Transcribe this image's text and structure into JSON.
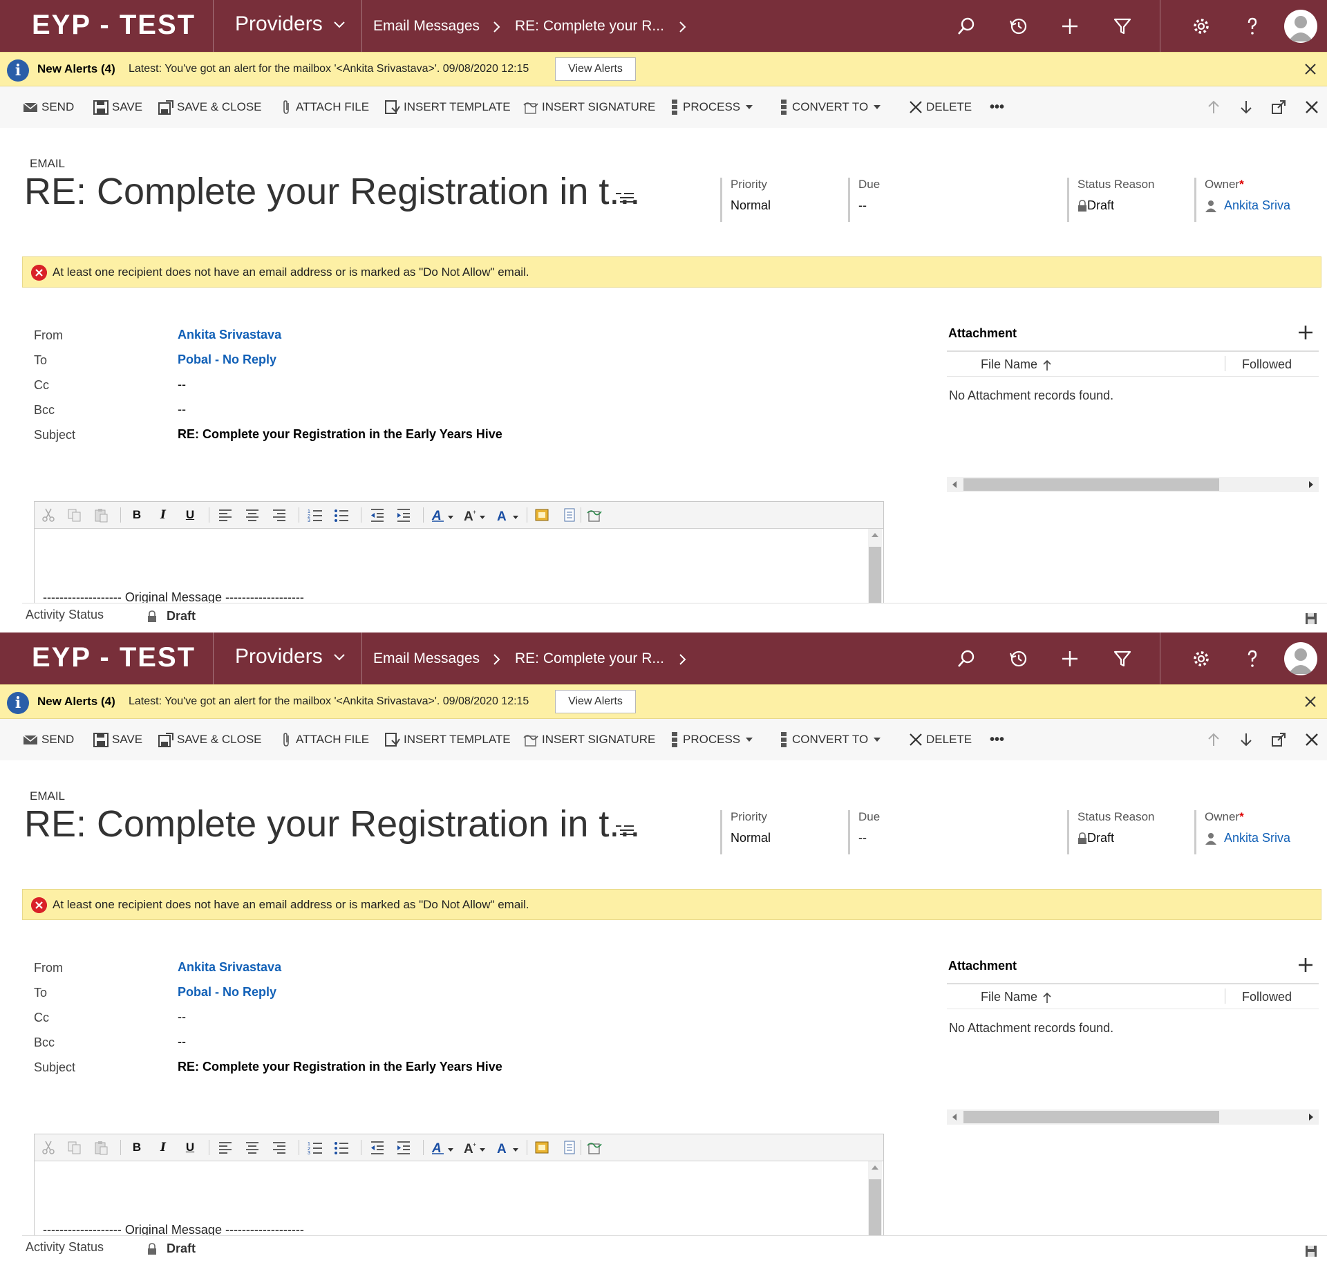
{
  "nav": {
    "logo": "EYP - TEST",
    "app_name": "Providers",
    "breadcrumb_1": "Email Messages",
    "breadcrumb_2": "RE: Complete your R...",
    "bg_color": "#782f3a"
  },
  "alert": {
    "title": "New Alerts (4)",
    "message": "Latest: You've got an alert for the mailbox '<Ankita Srivastava>'. 09/08/2020 12:15",
    "button": "View Alerts",
    "bg_color": "#fdf0a5"
  },
  "commands": {
    "send": "SEND",
    "save": "SAVE",
    "save_close": "SAVE & CLOSE",
    "attach_file": "ATTACH FILE",
    "insert_template": "INSERT TEMPLATE",
    "insert_signature": "INSERT SIGNATURE",
    "process": "PROCESS",
    "convert_to": "CONVERT TO",
    "delete": "DELETE",
    "more": "•••"
  },
  "header": {
    "entity_type": "EMAIL",
    "title": "RE: Complete your Registration in t...",
    "priority_label": "Priority",
    "priority_value": "Normal",
    "due_label": "Due",
    "due_value": "--",
    "status_reason_label": "Status Reason",
    "status_reason_value": "Draft",
    "owner_label": "Owner",
    "owner_required": "*",
    "owner_value": "Ankita Sriva"
  },
  "error": {
    "message": "At least one recipient does not have an email address or is marked as \"Do Not Allow\" email."
  },
  "fields": {
    "from_label": "From",
    "from_value": "Ankita Srivastava",
    "to_label": "To",
    "to_value": "Pobal - No Reply",
    "cc_label": "Cc",
    "cc_value": "--",
    "bcc_label": "Bcc",
    "bcc_value": "--",
    "subject_label": "Subject",
    "subject_value": "RE: Complete your Registration in the Early Years Hive"
  },
  "attachments": {
    "title": "Attachment",
    "col_file_name": "File Name",
    "col_followed": "Followed",
    "empty_message": "No Attachment records found."
  },
  "editor": {
    "bold": "B",
    "italic": "I",
    "underline": "U",
    "original_message": "------------------- Original Message -------------------"
  },
  "footer": {
    "activity_status_label": "Activity Status",
    "activity_status_value": "Draft"
  }
}
